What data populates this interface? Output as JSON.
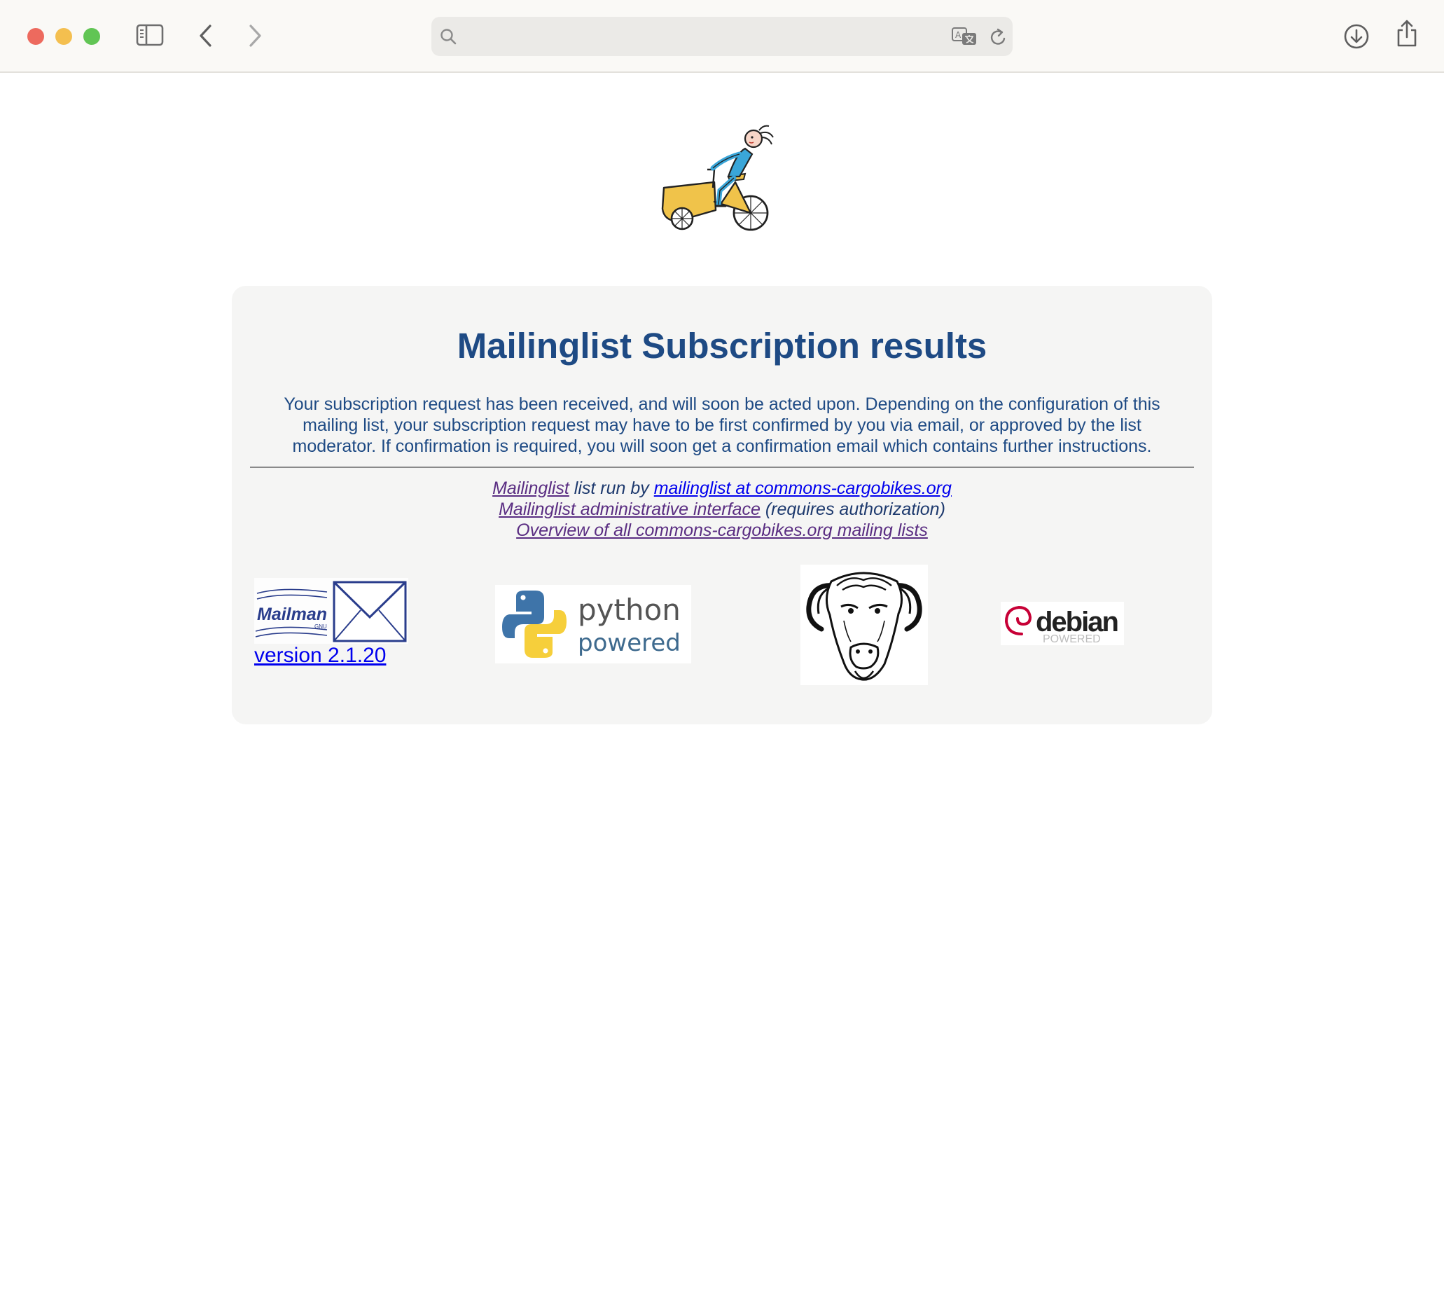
{
  "browser": {
    "address": {
      "value": "",
      "placeholder": ""
    }
  },
  "page": {
    "title": "Mailinglist Subscription results",
    "message": "Your subscription request has been received, and will soon be acted upon. Depending on the configuration of this mailing list, your subscription request may have to be first confirmed by you via email, or approved by the list moderator. If confirmation is required, you will soon get a confirmation email which contains further instructions.",
    "footer": {
      "list_link": "Mailinglist",
      "run_by_text": " list run by ",
      "owner_link": "mailinglist at commons-cargobikes.org",
      "admin_link": "Mailinglist administrative interface",
      "admin_note": " (requires authorization)",
      "overview_link": "Overview of all commons-cargobikes.org mailing lists"
    },
    "badges": {
      "mailman_text": "Mailman",
      "mailman_gnu": "GNU",
      "version_link": "version 2.1.20",
      "python_line1": "python",
      "python_line2": "powered",
      "debian_text": "debian",
      "debian_sub": "POWERED"
    }
  },
  "colors": {
    "heading": "#1e4a84",
    "link_visited": "#5a2d82",
    "link": "#0000ee",
    "panel_bg": "#f5f5f4"
  },
  "icons": [
    "sidebar-toggle-icon",
    "back-arrow-icon",
    "forward-arrow-icon",
    "search-icon",
    "translate-icon",
    "reload-icon",
    "download-icon",
    "share-icon",
    "cargobike-logo",
    "mailman-logo",
    "python-logo",
    "gnu-head-logo",
    "debian-logo"
  ]
}
